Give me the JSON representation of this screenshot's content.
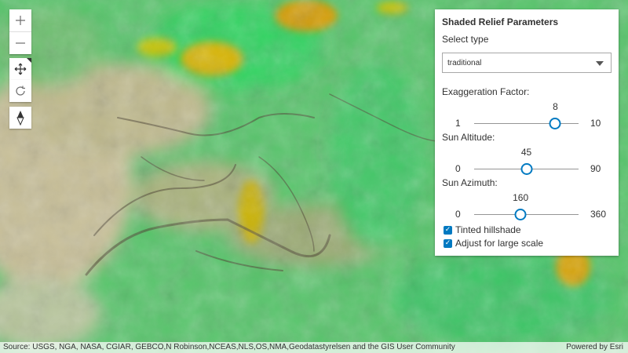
{
  "map": {
    "colors": {
      "low": "#c9bf96",
      "mid": "#2fc466",
      "high": "#d9a000",
      "shadow": "#5a4f3d"
    }
  },
  "nav": {
    "zoom_in_icon": "plus-icon",
    "zoom_out_icon": "minus-icon",
    "pan_icon": "move-icon",
    "rotate_icon": "rotate-icon",
    "compass_icon": "compass-icon"
  },
  "panel": {
    "title": "Shaded Relief Parameters",
    "select_label": "Select type",
    "select_value": "traditional",
    "sliders": [
      {
        "label": "Exaggeration Factor:",
        "min": 1,
        "max": 10,
        "value": 8
      },
      {
        "label": "Sun Altitude:",
        "min": 0,
        "max": 90,
        "value": 45
      },
      {
        "label": "Sun Azimuth:",
        "min": 0,
        "max": 360,
        "value": 160
      }
    ],
    "checkboxes": [
      {
        "label": "Tinted hillshade",
        "checked": true
      },
      {
        "label": "Adjust for large scale",
        "checked": true
      }
    ],
    "accent": "#007ac2"
  },
  "attribution": {
    "text": "Source: USGS, NGA, NASA, CGIAR, GEBCO,N Robinson,NCEAS,NLS,OS,NMA,Geodatastyrelsen and the GIS User Community",
    "powered": "Powered by Esri"
  }
}
